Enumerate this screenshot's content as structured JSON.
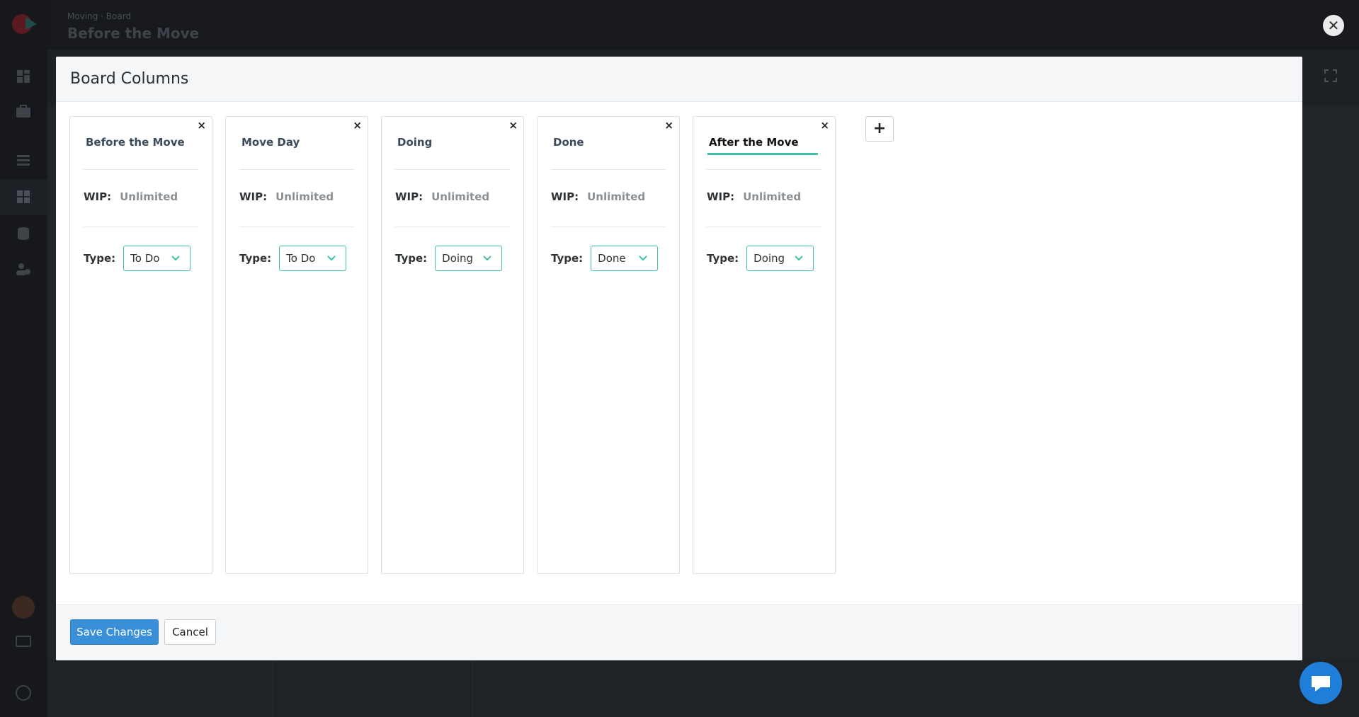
{
  "app": {
    "breadcrumb": "Moving · Board",
    "title": "Before the Move"
  },
  "modal": {
    "title": "Board Columns",
    "columns": [
      {
        "name": "Before the Move",
        "wip_label": "WIP:",
        "wip_value": "Unlimited",
        "type_label": "Type:",
        "type": "To Do"
      },
      {
        "name": "Move Day",
        "wip_label": "WIP:",
        "wip_value": "Unlimited",
        "type_label": "Type:",
        "type": "To Do"
      },
      {
        "name": "Doing",
        "wip_label": "WIP:",
        "wip_value": "Unlimited",
        "type_label": "Type:",
        "type": "Doing"
      },
      {
        "name": "Done",
        "wip_label": "WIP:",
        "wip_value": "Unlimited",
        "type_label": "Type:",
        "type": "Done"
      },
      {
        "name": "After the Move",
        "wip_label": "WIP:",
        "wip_value": "Unlimited",
        "type_label": "Type:",
        "type": "Doing"
      }
    ],
    "remove_glyph": "×",
    "add_glyph": "+",
    "save_label": "Save Changes",
    "cancel_label": "Cancel"
  },
  "overlay_close_glyph": "✕",
  "colors": {
    "accent": "#3fbfa6",
    "primary": "#3a8fd9",
    "chat": "#1f7fd8"
  }
}
